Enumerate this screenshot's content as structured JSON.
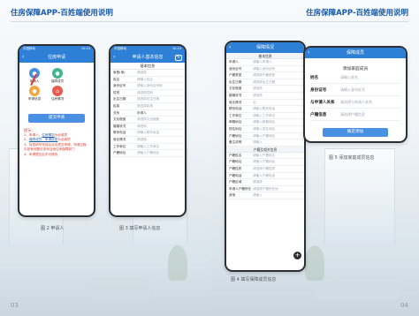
{
  "left": {
    "title": "住房保障APP-百姓端使用说明",
    "page_number": "03",
    "phone1": {
      "status_left": "中国移动",
      "status_right": "10:24",
      "nav_title": "住房申请",
      "icons": [
        {
          "label": "申请人",
          "color": "#4a90e2",
          "icon": "person-icon"
        },
        {
          "label": "保障成员",
          "color": "#3fb68b",
          "icon": "group-icon"
        },
        {
          "label": "申请信息",
          "color": "#f0a742",
          "icon": "info-icon"
        },
        {
          "label": "住房情况",
          "color": "#e85a4f",
          "icon": "house-icon"
        }
      ],
      "submit_label": "提交申请",
      "notes_head": "提示：",
      "notes": [
        {
          "pre": "1、申请人、",
          "hl": "住房情况",
          "post": "为必填项"
        },
        {
          "pre": "2、",
          "hl": "保障成员、申请信息",
          "post": "为必填项"
        },
        {
          "pre": "3、信息填写完成后点击提交申请，申请过程中如有问题可咨询当地住房保障部门",
          "hl": "",
          "post": ""
        },
        {
          "pre": "4、申请提交后不可修改",
          "hl": "",
          "post": ""
        }
      ],
      "caption": "图 2    申请人"
    },
    "phone2": {
      "status_left": "中国移动",
      "status_right": "10:24",
      "nav_title": "申请人基本信息",
      "section_title": "基本信息",
      "rows": [
        {
          "k": "家庭(单)",
          "v": "请选择"
        },
        {
          "k": "姓名",
          "v": "请输入姓名"
        },
        {
          "k": "身份证号",
          "v": "请输入身份证号码"
        },
        {
          "k": "性别",
          "v": "请选择性别"
        },
        {
          "k": "出生日期",
          "v": "请选择出生日期"
        },
        {
          "k": "民族",
          "v": "请选择民族"
        },
        {
          "k": "关系",
          "v": "申请人",
          "dark": true
        },
        {
          "k": "文化程度",
          "v": "请选择文化程度"
        },
        {
          "k": "婚姻状况",
          "v": "请选择"
        },
        {
          "k": "联系电话",
          "v": "请输入联系电话"
        },
        {
          "k": "就业情况",
          "v": "请选择"
        },
        {
          "k": "工作单位",
          "v": "请输入工作单位"
        },
        {
          "k": "户籍地址",
          "v": "请输入户籍地址"
        }
      ],
      "caption": "图 3    填写申请人信息"
    }
  },
  "right": {
    "title": "住房保障APP-百姓端使用说明",
    "page_number": "04",
    "phone3": {
      "nav_title": "保障情况",
      "section1": "基本信息",
      "rows1": [
        {
          "k": "申请人",
          "v": "请输入申请人"
        },
        {
          "k": "身份证号",
          "v": "请输入身份证号"
        },
        {
          "k": "户籍类型",
          "v": "请选择户籍类型"
        },
        {
          "k": "出生日期",
          "v": "请选择出生日期"
        },
        {
          "k": "文化程度",
          "v": "请选择"
        },
        {
          "k": "婚姻状况",
          "v": "请选择"
        },
        {
          "k": "就业情况",
          "v": "无"
        },
        {
          "k": "联系电话",
          "v": "请输入联系电话"
        },
        {
          "k": "工作单位",
          "v": "请输入工作单位"
        },
        {
          "k": "邮箱地址",
          "v": "请输入邮箱地址"
        },
        {
          "k": "现住地址",
          "v": "请输入现住地址"
        },
        {
          "k": "户籍地址",
          "v": "请输入户籍地址"
        },
        {
          "k": "备注说明",
          "v": "请输入"
        }
      ],
      "section2": "户籍及相关信息",
      "rows2": [
        {
          "k": "户籍姓名",
          "v": "请输入户籍姓名"
        },
        {
          "k": "户籍地址",
          "v": "请输入户籍地址"
        },
        {
          "k": "户籍性质",
          "v": "请选择户籍性质"
        },
        {
          "k": "户籍电话",
          "v": "请输入户籍电话"
        },
        {
          "k": "户籍区域",
          "v": "请选择"
        },
        {
          "k": "申请人户籍所在",
          "v": "请选择户籍所在地"
        },
        {
          "k": "其他",
          "v": "请输入"
        }
      ],
      "plus_label": "+",
      "caption": "图 4    填写保障成员信息"
    },
    "phone4": {
      "nav_title": "保障成员",
      "dialog_title": "添加家庭成员",
      "rows": [
        {
          "k": "姓名",
          "v": "请输入姓名"
        },
        {
          "k": "身份证号",
          "v": "请输入身份证号"
        },
        {
          "k": "与申请人关系",
          "v": "请选择与申请人关系"
        },
        {
          "k": "户籍信息",
          "v": "请选择户籍信息"
        }
      ],
      "confirm_label": "确定添加",
      "caption": "图 5    添加家庭成员信息"
    }
  }
}
